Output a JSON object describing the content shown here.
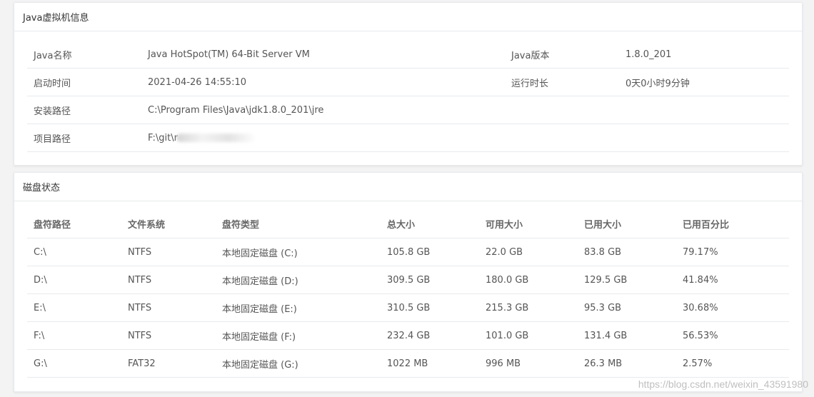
{
  "jvm_card": {
    "title": "Java虚拟机信息",
    "rows": [
      {
        "k1": "Java名称",
        "v1": "Java HotSpot(TM) 64-Bit Server VM",
        "k2": "Java版本",
        "v2": "1.8.0_201"
      },
      {
        "k1": "启动时间",
        "v1": "2021-04-26 14:55:10",
        "k2": "运行时长",
        "v2": "0天0小时9分钟"
      },
      {
        "k1": "安装路径",
        "v1": "C:\\Program Files\\Java\\jdk1.8.0_201\\jre",
        "k2": "",
        "v2": ""
      },
      {
        "k1": "项目路径",
        "v1": "F:\\git\\r",
        "k2": "",
        "v2": ""
      }
    ]
  },
  "disk_card": {
    "title": "磁盘状态",
    "columns": [
      "盘符路径",
      "文件系统",
      "盘符类型",
      "总大小",
      "可用大小",
      "已用大小",
      "已用百分比"
    ],
    "rows": [
      [
        "C:\\",
        "NTFS",
        "本地固定磁盘 (C:)",
        "105.8 GB",
        "22.0 GB",
        "83.8 GB",
        "79.17%"
      ],
      [
        "D:\\",
        "NTFS",
        "本地固定磁盘 (D:)",
        "309.5 GB",
        "180.0 GB",
        "129.5 GB",
        "41.84%"
      ],
      [
        "E:\\",
        "NTFS",
        "本地固定磁盘 (E:)",
        "310.5 GB",
        "215.3 GB",
        "95.3 GB",
        "30.68%"
      ],
      [
        "F:\\",
        "NTFS",
        "本地固定磁盘 (F:)",
        "232.4 GB",
        "101.0 GB",
        "131.4 GB",
        "56.53%"
      ],
      [
        "G:\\",
        "FAT32",
        "本地固定磁盘 (G:)",
        "1022 MB",
        "996 MB",
        "26.3 MB",
        "2.57%"
      ]
    ]
  },
  "watermark": "https://blog.csdn.net/weixin_43591980"
}
